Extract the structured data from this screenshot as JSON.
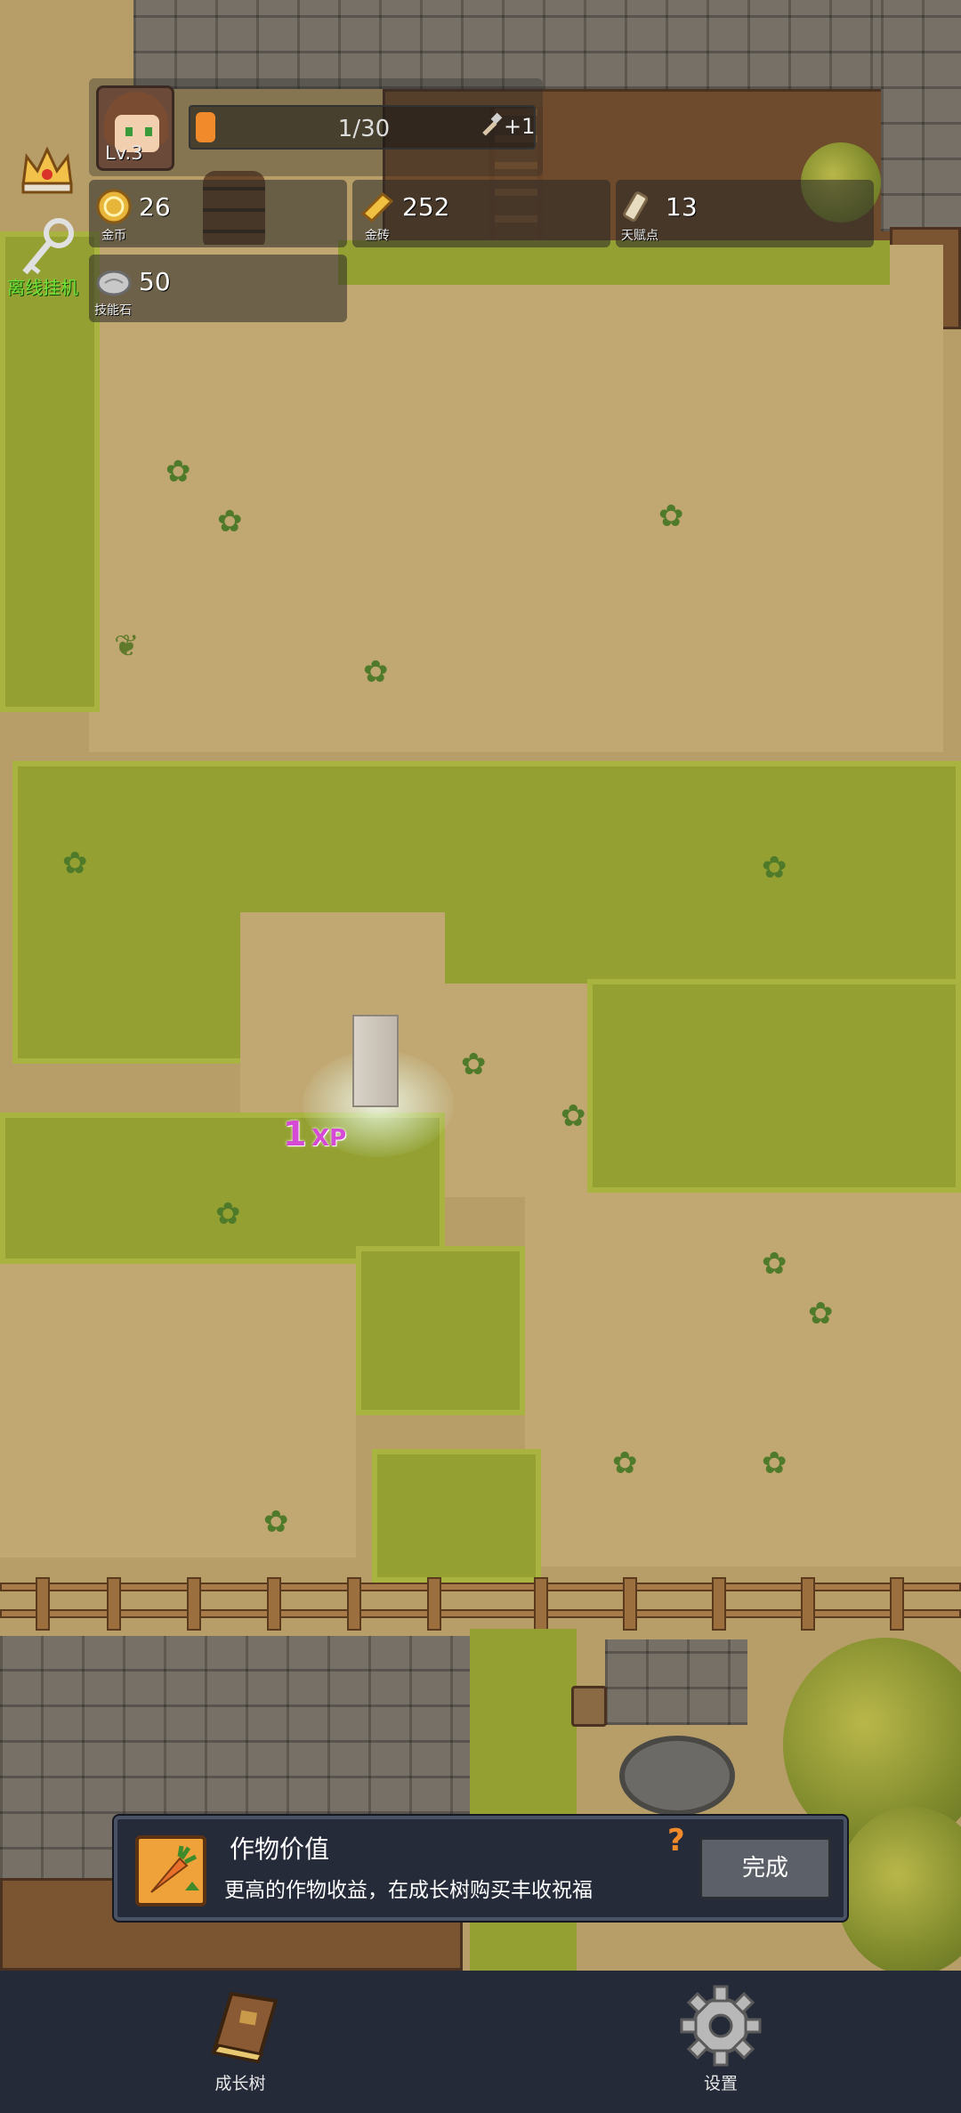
{
  "hud": {
    "level": "Lv.3",
    "xp_progress": "1/30",
    "xp_fraction": 0.0333,
    "tool_bonus": "+1",
    "resources": {
      "gold": {
        "value": "26",
        "caption": "金币"
      },
      "gold_brick": {
        "value": "252",
        "caption": "金砖"
      },
      "talent_points": {
        "value": "13",
        "caption": "天赋点"
      },
      "skill_stone": {
        "value": "50",
        "caption": "技能石"
      }
    },
    "idle_label": "离线挂机"
  },
  "floating_text": {
    "amount": "1",
    "unit": "XP"
  },
  "task": {
    "title": "作物价值",
    "description": "更高的作物收益，在成长树购买丰收祝福",
    "help": "?",
    "done_button": "完成"
  },
  "bottom_nav": {
    "growth_tree": "成长树",
    "settings": "设置"
  },
  "colors": {
    "xp_fill": "#f08a2a",
    "idle_label": "#6fe23a",
    "xp_float": "#d64bd6",
    "panel_bg": "#262b39",
    "bottom_bar": "#242a38"
  }
}
